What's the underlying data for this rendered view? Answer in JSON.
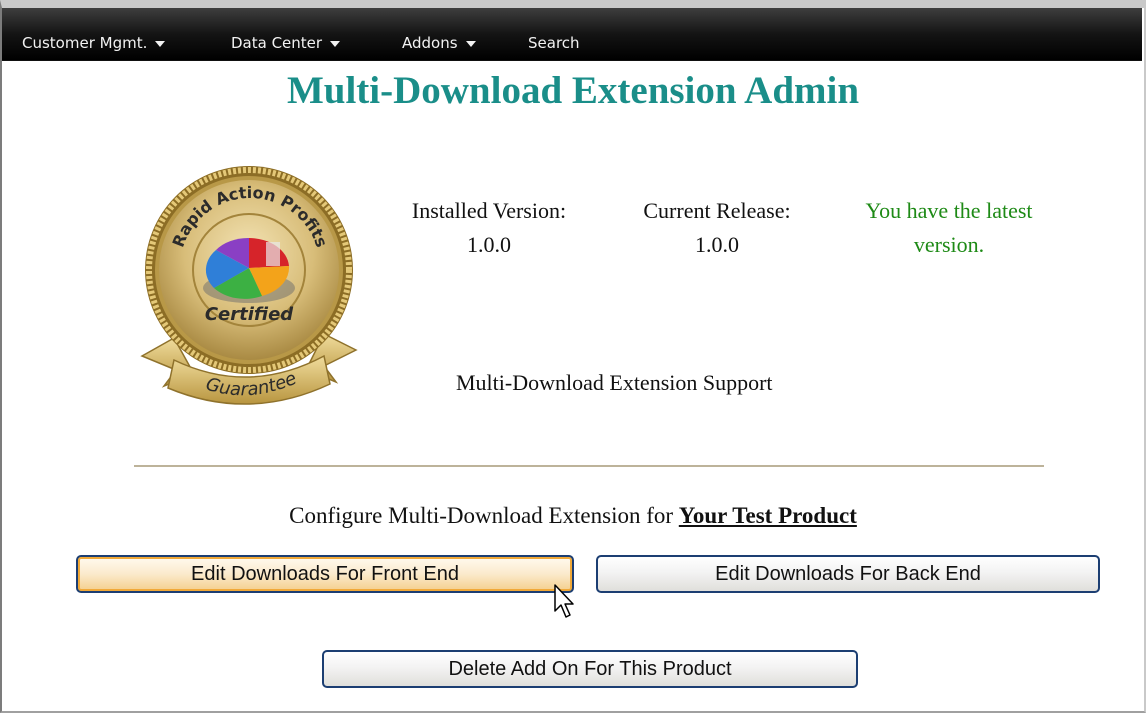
{
  "nav": {
    "items": [
      {
        "label": "Customer Mgmt.",
        "has_dropdown": true
      },
      {
        "label": "Data Center",
        "has_dropdown": true
      },
      {
        "label": "Addons",
        "has_dropdown": true
      },
      {
        "label": "Search",
        "has_dropdown": false
      }
    ]
  },
  "page_title": "Multi-Download Extension Admin",
  "badge": {
    "arc_text": "Rapid Action Profits",
    "center_text": "Certified",
    "ribbon_text": "Guarantee"
  },
  "version_info": {
    "installed_label": "Installed Version:",
    "installed_value": "1.0.0",
    "current_label": "Current Release:",
    "current_value": "1.0.0",
    "status_line1": "You have the latest",
    "status_line2": "version.",
    "status_color": "#1e8a16"
  },
  "support_text": "Multi-Download Extension Support",
  "configure": {
    "prefix": "Configure Multi-Download Extension for",
    "product_name": "Your Test Product"
  },
  "buttons": {
    "front_end": "Edit Downloads For Front End",
    "back_end": "Edit Downloads For Back End",
    "delete_addon": "Delete Add On For This Product"
  },
  "colors": {
    "title": "#1a8e89",
    "button_border": "#1c3e72",
    "button_hover_fill": "#f4cf8c"
  }
}
